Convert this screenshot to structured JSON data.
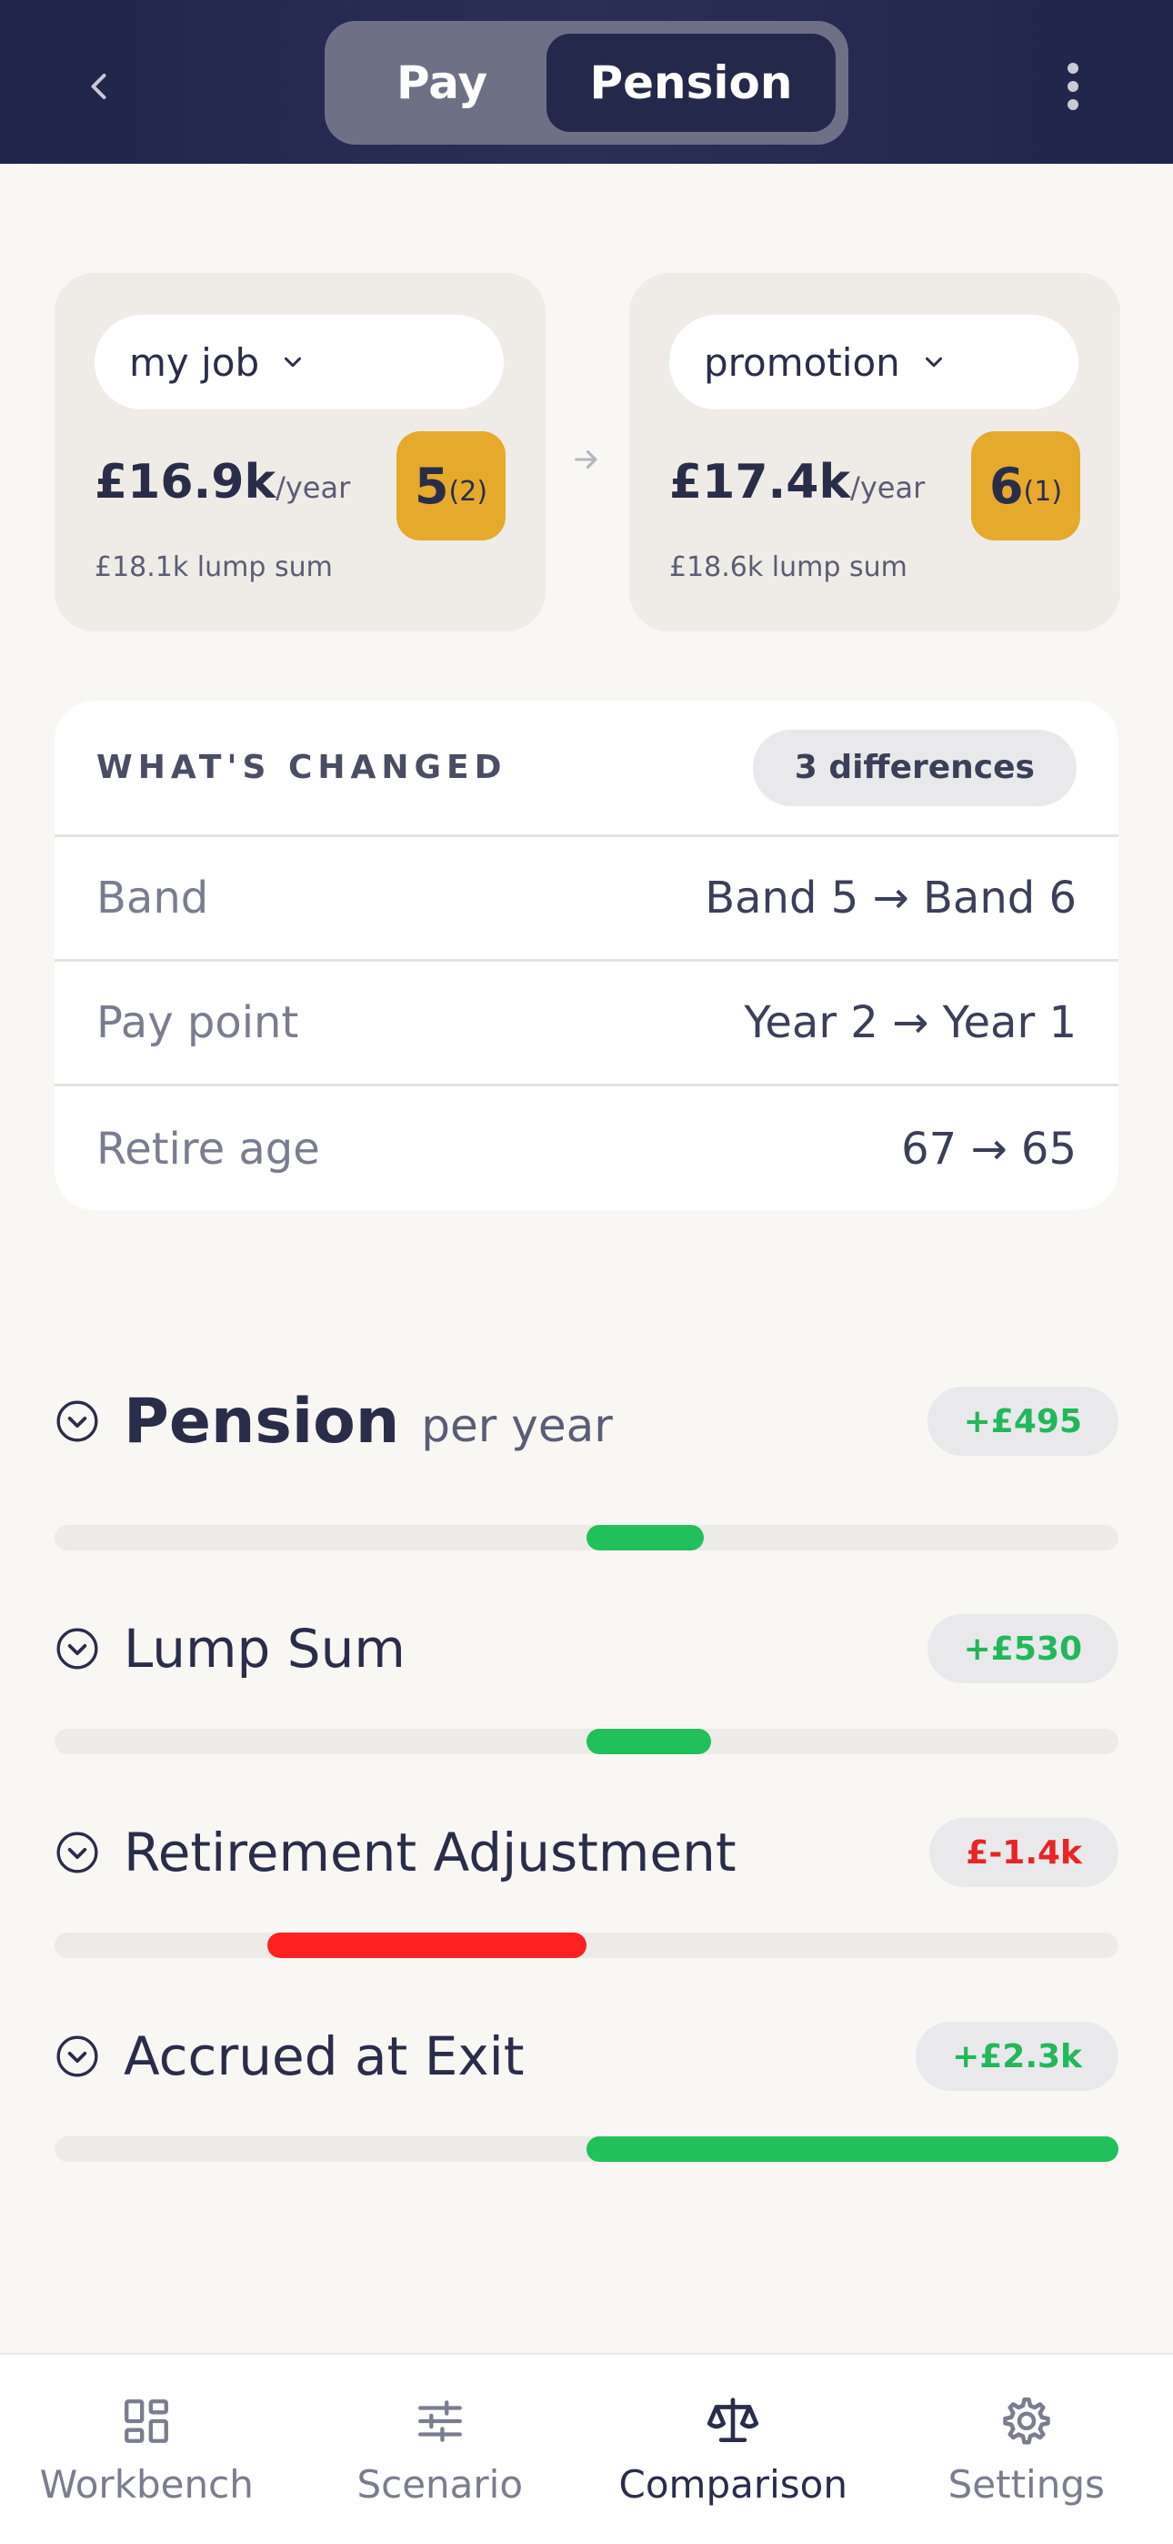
{
  "header": {
    "tabs": [
      {
        "label": "Pay",
        "active": false
      },
      {
        "label": "Pension",
        "active": true
      }
    ]
  },
  "comparison": {
    "left": {
      "scenario": "my job",
      "amount": "£16.9k",
      "unit": "/year",
      "lump_sum": "£18.1k lump sum",
      "band": "5",
      "point": "(2)"
    },
    "right": {
      "scenario": "promotion",
      "amount": "£17.4k",
      "unit": "/year",
      "lump_sum": "£18.6k lump sum",
      "band": "6",
      "point": "(1)"
    }
  },
  "changes": {
    "title": "WHAT'S CHANGED",
    "count": "3 differences",
    "rows": [
      {
        "label": "Band",
        "value": "Band 5 → Band 6"
      },
      {
        "label": "Pay point",
        "value": "Year 2 → Year 1"
      },
      {
        "label": "Retire age",
        "value": "67 → 65"
      }
    ]
  },
  "metrics": [
    {
      "title": "Pension",
      "subtitle": "per year",
      "delta": "+£495",
      "sign": "pos",
      "fill_from": 0.5,
      "fill_to": 0.61
    },
    {
      "title": "Lump Sum",
      "subtitle": "",
      "delta": "+£530",
      "sign": "pos",
      "fill_from": 0.5,
      "fill_to": 0.617
    },
    {
      "title": "Retirement Adjustment",
      "subtitle": "",
      "delta": "£-1.4k",
      "sign": "neg",
      "fill_from": 0.2,
      "fill_to": 0.5
    },
    {
      "title": "Accrued at Exit",
      "subtitle": "",
      "delta": "+£2.3k",
      "sign": "pos",
      "fill_from": 0.5,
      "fill_to": 1.0
    }
  ],
  "tabbar": {
    "items": [
      {
        "label": "Workbench",
        "icon": "dashboard-icon",
        "active": false
      },
      {
        "label": "Scenario",
        "icon": "sliders-icon",
        "active": false
      },
      {
        "label": "Comparison",
        "icon": "scale-icon",
        "active": true
      },
      {
        "label": "Settings",
        "icon": "gear-icon",
        "active": false
      }
    ]
  },
  "colors": {
    "header": "#1f2449",
    "accent_badge": "#e5a92c",
    "positive": "#22c05a",
    "negative": "#ff2121"
  }
}
